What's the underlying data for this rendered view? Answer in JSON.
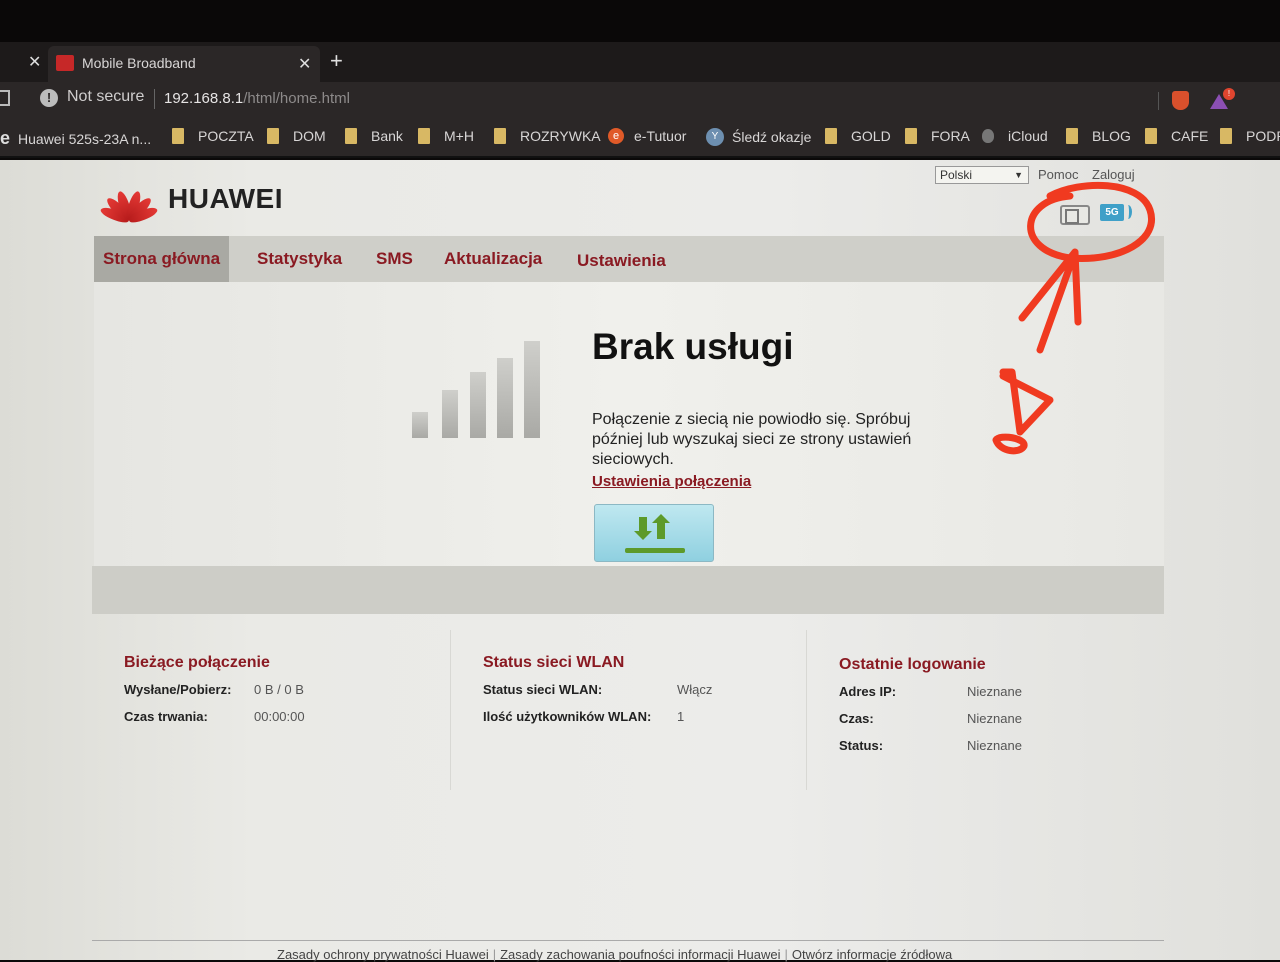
{
  "browser": {
    "tab_title": "Mobile Broadband",
    "security_label": "Not secure",
    "url_host": "192.168.8.1",
    "url_path": "/html/home.html",
    "rewards_badge": "!",
    "bookmarks": [
      {
        "label": "Huawei 525s-23A n...",
        "icon": "ie-icon"
      },
      {
        "label": "POCZTA",
        "icon": "folder-icon"
      },
      {
        "label": "DOM",
        "icon": "folder-icon"
      },
      {
        "label": "Bank",
        "icon": "folder-icon"
      },
      {
        "label": "M+H",
        "icon": "folder-icon"
      },
      {
        "label": "ROZRYWKA",
        "icon": "folder-icon"
      },
      {
        "label": "e-Tutuor",
        "icon": "etutor-icon"
      },
      {
        "label": "Śledź okazje",
        "icon": "site-icon"
      },
      {
        "label": "GOLD",
        "icon": "folder-icon"
      },
      {
        "label": "FORA",
        "icon": "folder-icon"
      },
      {
        "label": "iCloud",
        "icon": "apple-icon"
      },
      {
        "label": "BLOG",
        "icon": "folder-icon"
      },
      {
        "label": "CAFE",
        "icon": "folder-icon"
      },
      {
        "label": "PODR",
        "icon": "folder-icon"
      }
    ]
  },
  "header": {
    "logo_text": "HUAWEI",
    "language": "Polski",
    "help": "Pomoc",
    "login": "Zaloguj",
    "network_badge": "5G"
  },
  "nav": {
    "items": [
      {
        "label": "Strona główna",
        "active": true
      },
      {
        "label": "Statystyka",
        "active": false
      },
      {
        "label": "SMS",
        "active": false
      },
      {
        "label": "Aktualizacja",
        "active": false
      },
      {
        "label": "Ustawienia",
        "active": false
      }
    ]
  },
  "status": {
    "signal_bars_active": 0,
    "signal_bars_total": 5,
    "title": "Brak usługi",
    "message": "Połączenie z siecią nie powiodło się. Spróbuj później lub wyszukaj sieci ze strony ustawień sieciowych.",
    "link": "Ustawienia połączenia"
  },
  "panels": {
    "connection": {
      "title": "Bieżące połączenie",
      "rows": [
        {
          "label": "Wysłane/Pobierz:",
          "value": "0 B / 0 B"
        },
        {
          "label": "Czas trwania:",
          "value": "00:00:00"
        }
      ]
    },
    "wlan": {
      "title": "Status sieci WLAN",
      "rows": [
        {
          "label": "Status sieci WLAN:",
          "value": "Włącz"
        },
        {
          "label": "Ilość użytkowników WLAN:",
          "value": "1"
        }
      ]
    },
    "login": {
      "title": "Ostatnie logowanie",
      "rows": [
        {
          "label": "Adres IP:",
          "value": "Nieznane"
        },
        {
          "label": "Czas:",
          "value": "Nieznane"
        },
        {
          "label": "Status:",
          "value": "Nieznane"
        }
      ]
    }
  },
  "footer": {
    "links": [
      "Zasady ochrony prywatności Huawei",
      "Zasady zachowania poufności informacji Huawei",
      "Otwórz informacje źródłowa"
    ]
  },
  "annotation": {
    "text": "D",
    "color": "#f03a20"
  }
}
